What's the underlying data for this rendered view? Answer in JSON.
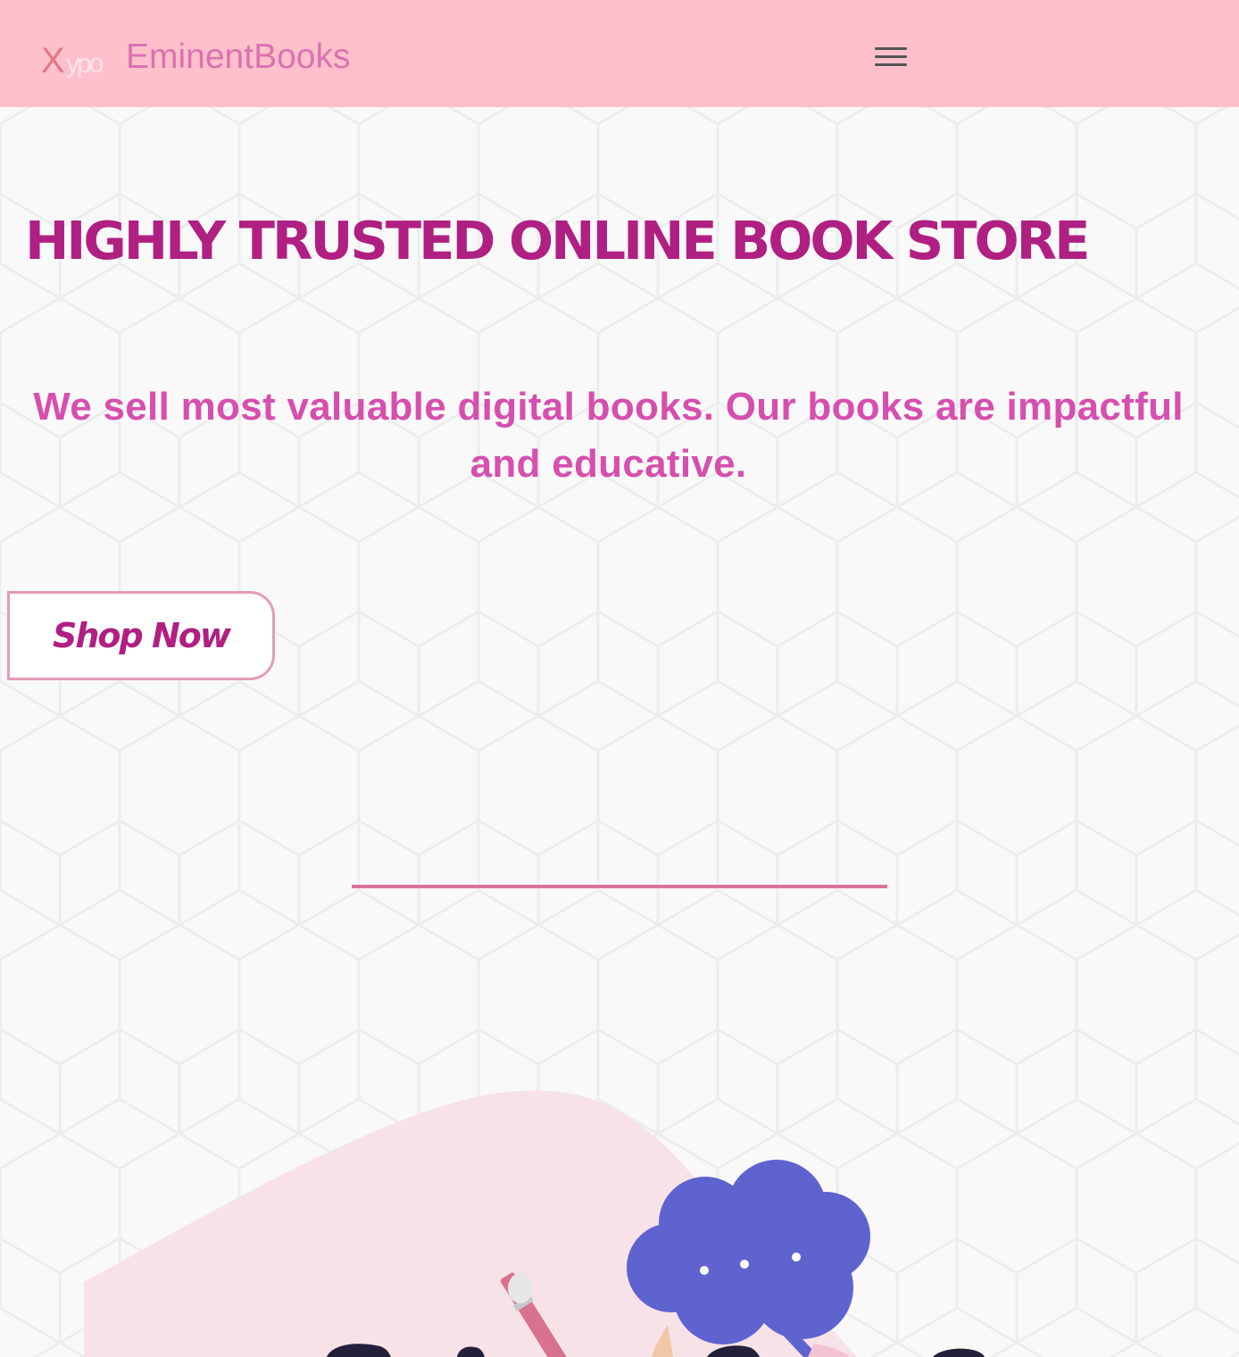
{
  "header": {
    "logo": {
      "initial": "X",
      "rest": "ypo"
    },
    "brand_name": "EminentBooks",
    "menu_icon": "hamburger-menu-icon"
  },
  "hero": {
    "title": "HIGHLY TRUSTED ONLINE BOOK STORE",
    "subtitle": "We sell most valuable digital books. Our books are impactful and educative.",
    "cta_label": "Shop Now"
  },
  "colors": {
    "header_bg": "#ffc0cb",
    "brand": "#db72b0",
    "title": "#b01f82",
    "subtitle": "#d64fae",
    "divider": "#d9729a",
    "speech_bubble": "#5f63d0",
    "page_bg": "#f9f9f9"
  },
  "illustration": {
    "speech_bubble_icon": "speech-bubble-icon",
    "pencil_icon": "pencil-icon"
  }
}
